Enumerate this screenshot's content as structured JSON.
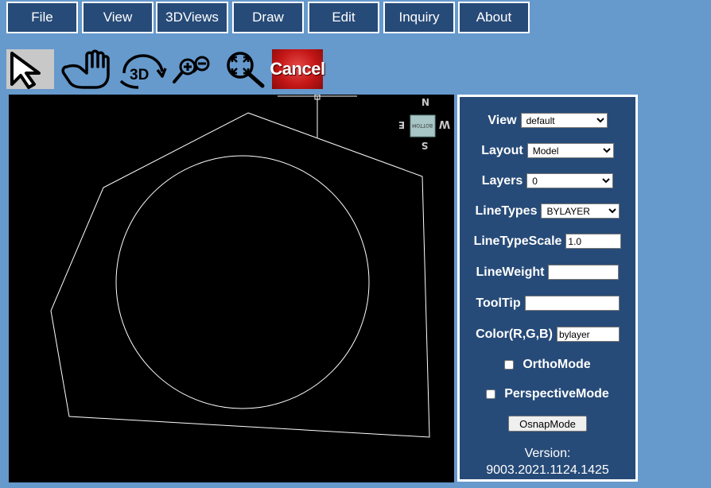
{
  "menu": {
    "items": [
      "File",
      "View",
      "3DViews",
      "Draw",
      "Edit",
      "Inquiry",
      "About"
    ]
  },
  "toolbar": {
    "select_icon": "arrow-cursor-icon",
    "pan_icon": "hand-icon",
    "orbit_icon": "3d-rotate-icon",
    "zoom_icon": "zoom-in-out-icon",
    "fit_icon": "zoom-extents-icon",
    "cancel_label": "Cancel"
  },
  "viewcube": {
    "north": "N",
    "south": "S",
    "east": "E",
    "west": "W",
    "face": "BOTTOM"
  },
  "panel": {
    "view": {
      "label": "View",
      "value": "default"
    },
    "layout": {
      "label": "Layout",
      "value": "Model"
    },
    "layers": {
      "label": "Layers",
      "value": "0"
    },
    "linetypes": {
      "label": "LineTypes",
      "value": "BYLAYER"
    },
    "linetypescale": {
      "label": "LineTypeScale",
      "value": "1.0"
    },
    "lineweight": {
      "label": "LineWeight",
      "value": ""
    },
    "tooltip": {
      "label": "ToolTip",
      "value": ""
    },
    "color": {
      "label": "Color(R,G,B)",
      "value": "bylayer"
    },
    "orthomode": {
      "label": "OrthoMode",
      "checked": false
    },
    "perspectivemode": {
      "label": "PerspectiveMode",
      "checked": false
    },
    "osnap_label": "OsnapMode",
    "version_label": "Version:",
    "version_value": "9003.2021.1124.1425"
  },
  "colors": {
    "page_bg": "#6699cc",
    "menu_bg": "#274b78",
    "canvas_bg": "#000000",
    "drawing_stroke": "#ffffff",
    "cancel_red": "#c41616"
  }
}
